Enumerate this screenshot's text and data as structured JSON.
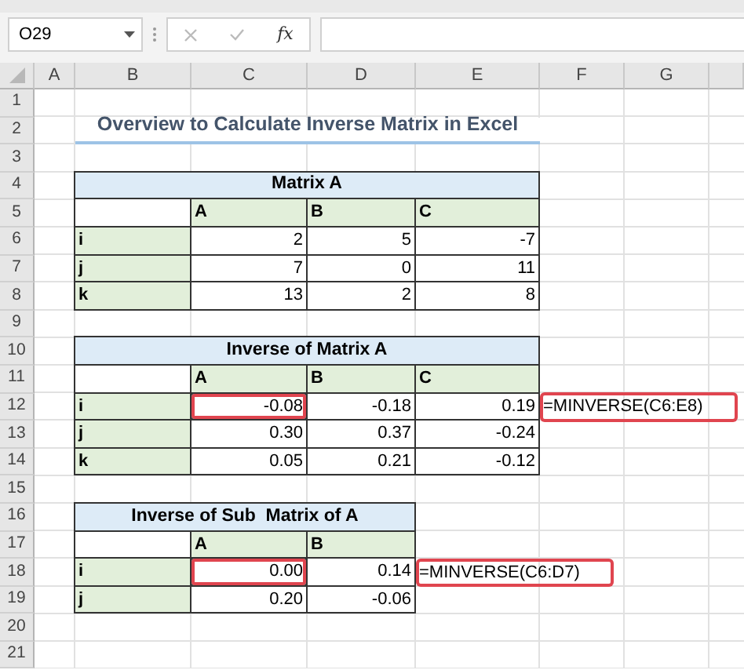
{
  "name_box": {
    "value": "O29"
  },
  "formula_bar": {
    "function_label": "fx"
  },
  "columns": [
    "A",
    "B",
    "C",
    "D",
    "E",
    "F",
    "G"
  ],
  "rows": [
    {
      "number": "1",
      "cells": []
    },
    {
      "number": "2",
      "cells": [
        {
          "kind": "heading",
          "text": "Overview to Calculate Inverse Matrix in Excel"
        }
      ]
    },
    {
      "number": "3",
      "cells": []
    },
    {
      "number": "4",
      "cells": [
        {
          "kind": "title",
          "text": "Matrix A"
        }
      ]
    },
    {
      "number": "5",
      "cells": [
        {
          "kind": "blank"
        },
        {
          "kind": "header",
          "text": "A"
        },
        {
          "kind": "header",
          "text": "B"
        },
        {
          "kind": "header",
          "text": "C"
        }
      ]
    },
    {
      "number": "6",
      "cells": [
        {
          "kind": "label",
          "text": "i"
        },
        {
          "kind": "number",
          "text": "2",
          "highlighted": false
        },
        {
          "kind": "number",
          "text": "5",
          "highlighted": false
        },
        {
          "kind": "number",
          "text": "-7",
          "highlighted": false
        }
      ]
    },
    {
      "number": "7",
      "cells": [
        {
          "kind": "label",
          "text": "j"
        },
        {
          "kind": "number",
          "text": "7",
          "highlighted": false
        },
        {
          "kind": "number",
          "text": "0",
          "highlighted": false
        },
        {
          "kind": "number",
          "text": "11",
          "highlighted": false
        }
      ]
    },
    {
      "number": "8",
      "cells": [
        {
          "kind": "label",
          "text": "k"
        },
        {
          "kind": "number",
          "text": "13",
          "highlighted": false
        },
        {
          "kind": "number",
          "text": "2",
          "highlighted": false
        },
        {
          "kind": "number",
          "text": "8",
          "highlighted": false
        }
      ]
    },
    {
      "number": "9",
      "cells": []
    },
    {
      "number": "10",
      "cells": [
        {
          "kind": "title",
          "text": "Inverse of Matrix A"
        }
      ]
    },
    {
      "number": "11",
      "cells": [
        {
          "kind": "blank"
        },
        {
          "kind": "header",
          "text": "A"
        },
        {
          "kind": "header",
          "text": "B"
        },
        {
          "kind": "header",
          "text": "C"
        }
      ]
    },
    {
      "number": "12",
      "cells": [
        {
          "kind": "label",
          "text": "i"
        },
        {
          "kind": "number",
          "text": "-0.08",
          "highlighted": true
        },
        {
          "kind": "number",
          "text": "-0.18",
          "highlighted": false
        },
        {
          "kind": "number",
          "text": "0.19",
          "highlighted": false
        },
        {
          "kind": "formula",
          "text": "=MINVERSE(C6:E8)",
          "highlighted": true
        }
      ]
    },
    {
      "number": "13",
      "cells": [
        {
          "kind": "label",
          "text": "j"
        },
        {
          "kind": "number",
          "text": "0.30",
          "highlighted": false
        },
        {
          "kind": "number",
          "text": "0.37",
          "highlighted": false
        },
        {
          "kind": "number",
          "text": "-0.24",
          "highlighted": false
        }
      ]
    },
    {
      "number": "14",
      "cells": [
        {
          "kind": "label",
          "text": "k"
        },
        {
          "kind": "number",
          "text": "0.05",
          "highlighted": false
        },
        {
          "kind": "number",
          "text": "0.21",
          "highlighted": false
        },
        {
          "kind": "number",
          "text": "-0.12",
          "highlighted": false
        }
      ]
    },
    {
      "number": "15",
      "cells": []
    },
    {
      "number": "16",
      "cells": [
        {
          "kind": "title",
          "text": "Inverse of Sub  Matrix of A"
        }
      ]
    },
    {
      "number": "17",
      "cells": [
        {
          "kind": "blank"
        },
        {
          "kind": "header",
          "text": "A"
        },
        {
          "kind": "header",
          "text": "B"
        }
      ]
    },
    {
      "number": "18",
      "cells": [
        {
          "kind": "label",
          "text": "i"
        },
        {
          "kind": "number",
          "text": "0.00",
          "highlighted": true
        },
        {
          "kind": "number",
          "text": "0.14",
          "highlighted": false
        },
        {
          "kind": "formula",
          "text": "=MINVERSE(C6:D7)",
          "highlighted": true
        }
      ]
    },
    {
      "number": "19",
      "cells": [
        {
          "kind": "label",
          "text": "j"
        },
        {
          "kind": "number",
          "text": "0.20",
          "highlighted": false
        },
        {
          "kind": "number",
          "text": "-0.06",
          "highlighted": false
        }
      ]
    },
    {
      "number": "20",
      "cells": []
    },
    {
      "number": "21",
      "cells": []
    }
  ]
}
